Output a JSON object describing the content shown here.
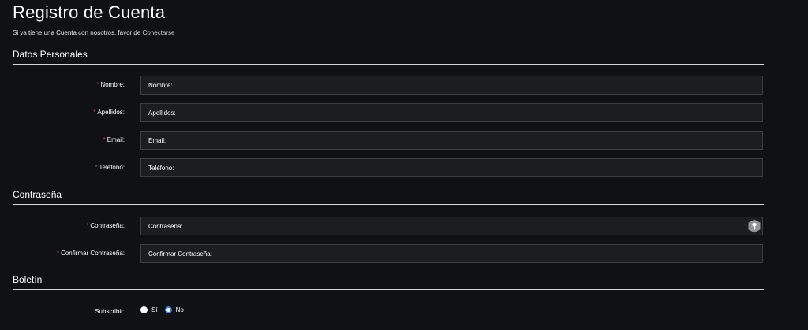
{
  "page": {
    "title": "Registro de Cuenta",
    "subtitle_prefix": "Si ya tiene una Cuenta con nosotros, favor de ",
    "subtitle_link": "Conectarse"
  },
  "sections": {
    "personal": {
      "heading": "Datos Personales"
    },
    "password": {
      "heading": "Contraseña"
    },
    "newsletter": {
      "heading": "Boletín"
    }
  },
  "fields": {
    "nombre": {
      "label": "Nombre:",
      "placeholder": "Nombre:",
      "required_mark": "*"
    },
    "apellidos": {
      "label": "Apellidos:",
      "placeholder": "Apellidos:",
      "required_mark": "*"
    },
    "email": {
      "label": "Email:",
      "placeholder": "Email:",
      "required_mark": "*"
    },
    "telefono": {
      "label": "Teléfono:",
      "placeholder": "Teléfono:",
      "required_mark": "*"
    },
    "contrasena": {
      "label": "Contraseña:",
      "placeholder": "Contraseña:",
      "required_mark": "*"
    },
    "confirmar": {
      "label": "Confirmar Contraseña:",
      "placeholder": "Confirmar Contraseña:",
      "required_mark": "*"
    }
  },
  "newsletter": {
    "label": "Subscribir:",
    "options": [
      {
        "label": "Sí",
        "checked": false
      },
      {
        "label": "No",
        "checked": true
      }
    ]
  },
  "icons": {
    "password_field": "key-icon"
  },
  "colors": {
    "background": "#101114",
    "field_background": "#1b1d21",
    "required": "#e23a3a",
    "radio_accent": "#3b7de0"
  }
}
